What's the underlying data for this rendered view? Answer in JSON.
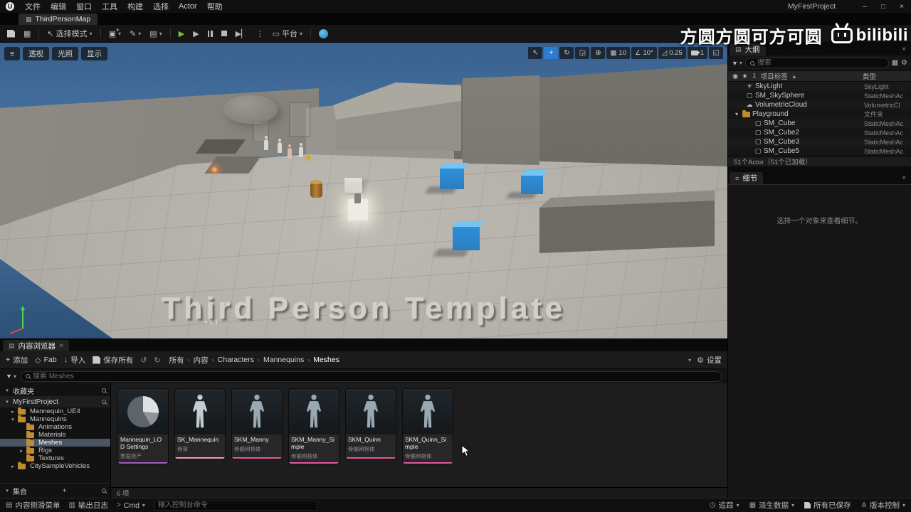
{
  "titlebar": {
    "menu": [
      "文件",
      "编辑",
      "窗口",
      "工具",
      "构建",
      "选择",
      "Actor",
      "帮助"
    ],
    "project": "MyFirstProject"
  },
  "tabbar": {
    "map_tab": "ThirdPersonMap"
  },
  "toolbar": {
    "mode": "选择模式",
    "platform": "平台"
  },
  "watermark": {
    "text": "方圆方圆可方可圆",
    "logo": "bilibili"
  },
  "viewport": {
    "menu_labels": {
      "perspective": "透视",
      "lit": "光照",
      "show": "显示"
    },
    "snaps": {
      "grid": "10",
      "rotation": "10°",
      "scale": "0.25",
      "camera_speed": "1"
    },
    "overlay_text": "Third Person Template",
    "hud_label": "1.1"
  },
  "outliner": {
    "tab": "大纲",
    "search_placeholder": "搜索",
    "col_item": "项目标签",
    "col_type": "类型",
    "rows": [
      {
        "label": "SkyLight",
        "type": "SkyLight"
      },
      {
        "label": "SM_SkySphere",
        "type": "StaticMeshAc"
      },
      {
        "label": "VolumetricCloud",
        "type": "VolumetricCl"
      },
      {
        "label": "Playground",
        "type": "文件夹"
      },
      {
        "label": "SM_Cube",
        "type": "StaticMeshAc"
      },
      {
        "label": "SM_Cube2",
        "type": "StaticMeshAc"
      },
      {
        "label": "SM_Cube3",
        "type": "StaticMeshAc"
      },
      {
        "label": "SM_Cube5",
        "type": "StaticMeshAc"
      }
    ],
    "status": "51个Actor（51个已加载）"
  },
  "details": {
    "tab": "细节",
    "empty": "选择一个对象来查看细节。"
  },
  "content_browser": {
    "tab": "内容浏览器",
    "add": "添加",
    "fab": "Fab",
    "import": "导入",
    "save_all": "保存所有",
    "breadcrumb": [
      "所有",
      "内容",
      "Characters",
      "Mannequins",
      "Meshes"
    ],
    "settings": "设置",
    "search_placeholder": "搜索 Meshes",
    "favorites": "收藏夹",
    "root": "MyFirstProject",
    "tree": [
      {
        "label": "Mannequin_UE4"
      },
      {
        "label": "Mannequins"
      },
      {
        "label": "Animations"
      },
      {
        "label": "Materials"
      },
      {
        "label": "Meshes"
      },
      {
        "label": "Rigs"
      },
      {
        "label": "Textures"
      },
      {
        "label": "CitySampleVehicles"
      }
    ],
    "collections": "集合",
    "assets": [
      {
        "name": "Mannequin_LOD Settings",
        "type": "数据资产"
      },
      {
        "name": "SK_Mannequin",
        "type": "骨架"
      },
      {
        "name": "SKM_Manny",
        "type": "骨骼网格体"
      },
      {
        "name": "SKM_Manny_Simple",
        "type": "骨骼网格体"
      },
      {
        "name": "SKM_Quinn",
        "type": "骨骼网格体"
      },
      {
        "name": "SKM_Quinn_Simple",
        "type": "骨骼网格体"
      }
    ],
    "count": "6 项"
  },
  "statusbar": {
    "content_drawer": "内容侧滑菜单",
    "output_log": "输出日志",
    "cmd": "Cmd",
    "console_placeholder": "输入控制台命令",
    "trace": "追踪",
    "derived_data": "派生数据",
    "all_saved": "所有已保存",
    "revision_control": "版本控制"
  },
  "colors": {
    "accent_blue": "#2e7bd0",
    "cube_blue": "#2f8fd8",
    "folder_gold": "#c08a2e",
    "play_green": "#77c043",
    "stripe_skeletal_mesh": "#e457a2",
    "stripe_skeleton": "#f0a0b8",
    "stripe_data_asset": "#a259c9"
  }
}
